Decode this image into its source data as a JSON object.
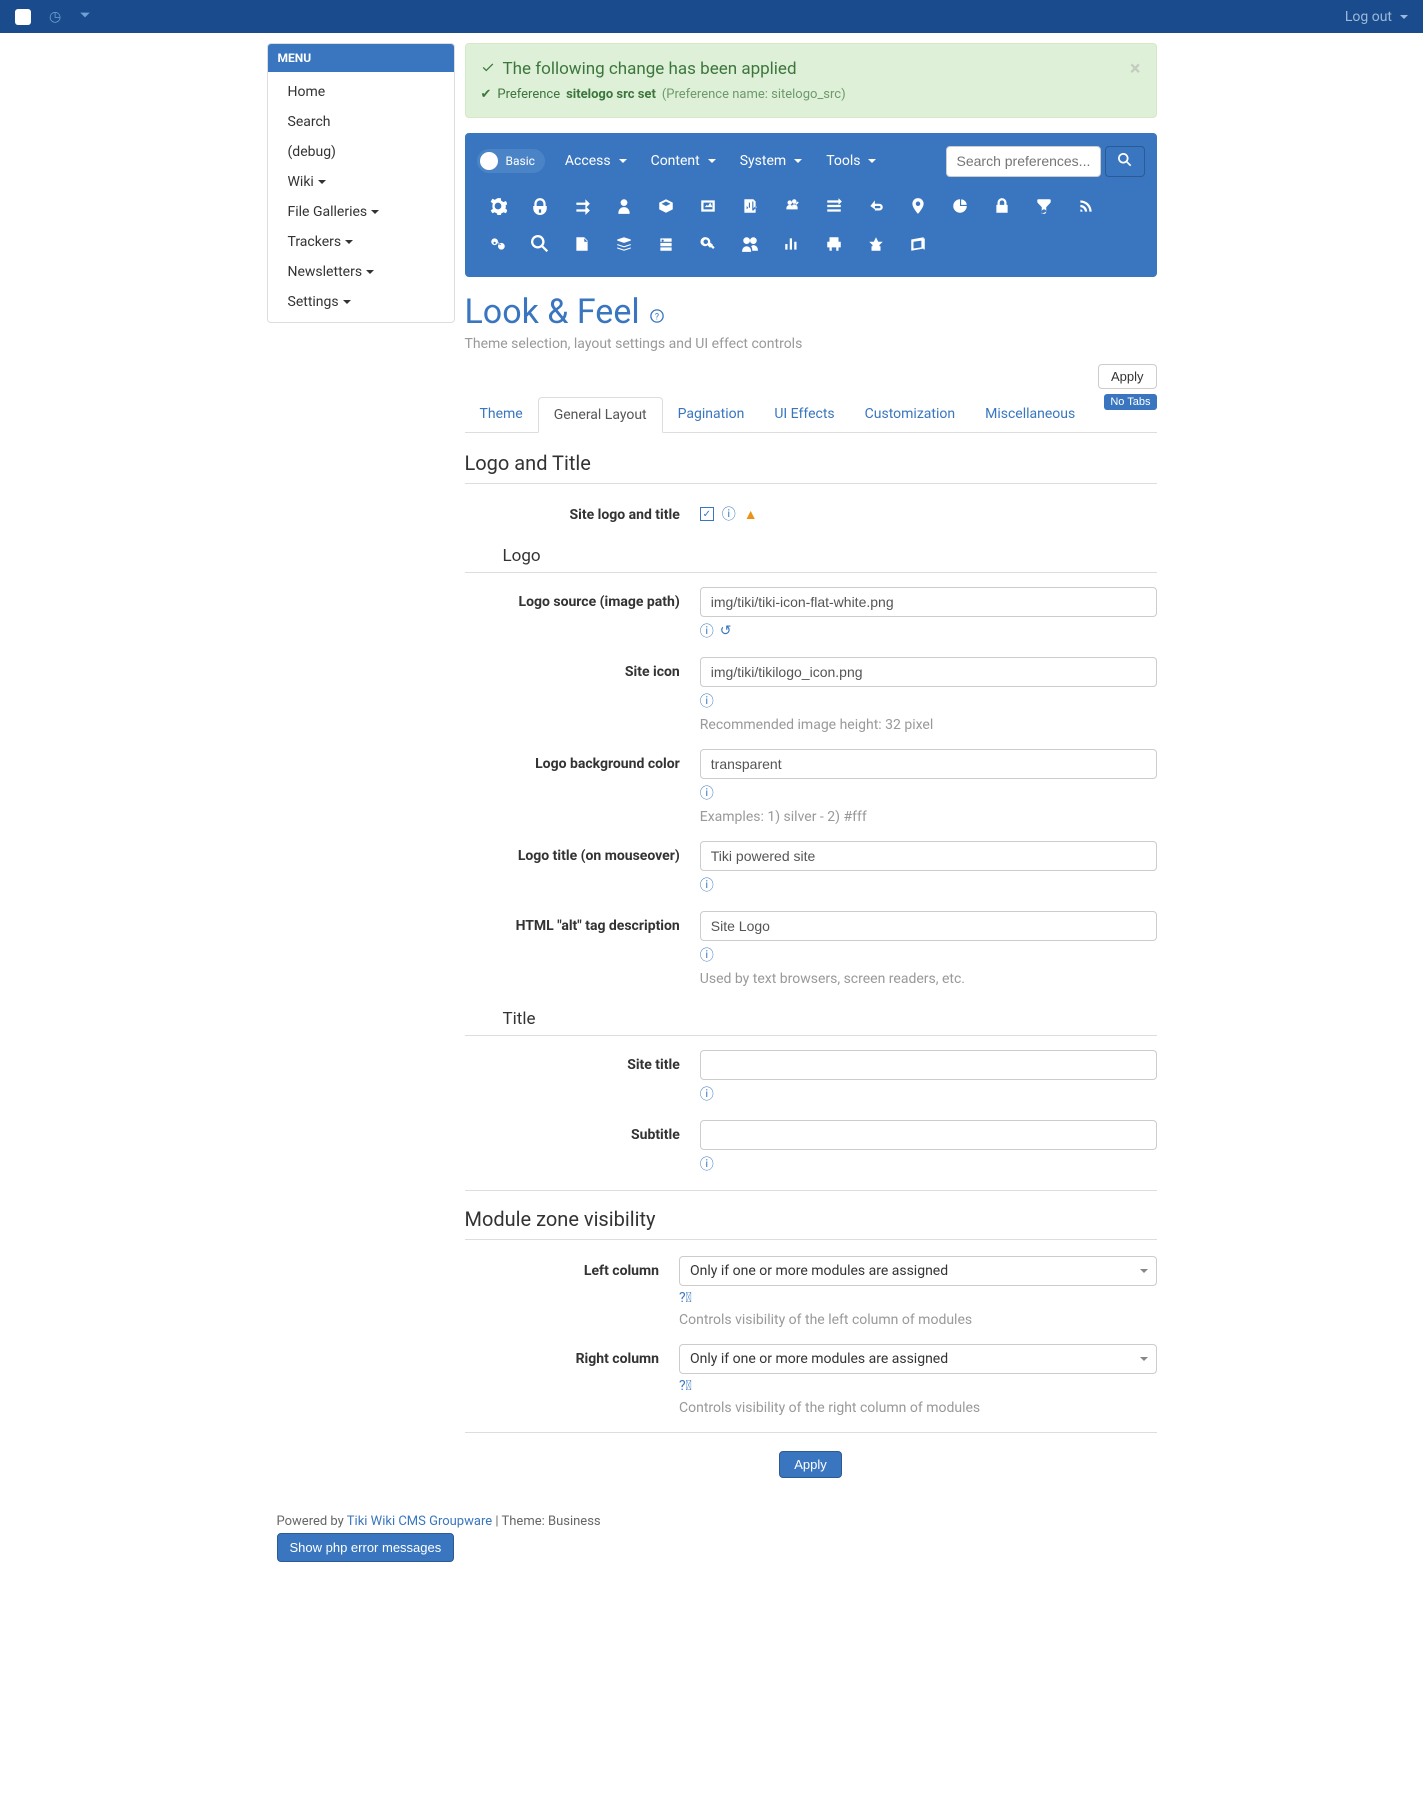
{
  "topbar": {
    "logout_label": "Log out"
  },
  "sidebar": {
    "header": "MENU",
    "items": [
      {
        "label": "Home",
        "caret": false
      },
      {
        "label": "Search",
        "caret": false
      },
      {
        "label": "(debug)",
        "caret": false
      },
      {
        "label": "Wiki",
        "caret": true
      },
      {
        "label": "File Galleries",
        "caret": true
      },
      {
        "label": "Trackers",
        "caret": true
      },
      {
        "label": "Newsletters",
        "caret": true
      },
      {
        "label": "Settings",
        "caret": true
      }
    ]
  },
  "alert": {
    "title": "The following change has been applied",
    "pref_label": "Preference",
    "pref_bold": "sitelogo src set",
    "pref_hint": "(Preference name: sitelogo_src)"
  },
  "prefnav": {
    "basic_label": "Basic",
    "links": [
      "Access",
      "Content",
      "System",
      "Tools"
    ],
    "search_placeholder": "Search preferences..."
  },
  "page": {
    "title": "Look & Feel",
    "subtitle": "Theme selection, layout settings and UI effect controls",
    "apply_label": "Apply",
    "no_tabs_label": "No Tabs"
  },
  "tabs": [
    "Theme",
    "General Layout",
    "Pagination",
    "UI Effects",
    "Customization",
    "Miscellaneous"
  ],
  "active_tab": 1,
  "section1": {
    "heading": "Logo and Title",
    "site_logo_title_label": "Site logo and title",
    "logo_heading": "Logo",
    "logo_source_label": "Logo source (image path)",
    "logo_source_value": "img/tiki/tiki-icon-flat-white.png",
    "site_icon_label": "Site icon",
    "site_icon_value": "img/tiki/tikilogo_icon.png",
    "site_icon_help": "Recommended image height: 32 pixel",
    "logo_bg_label": "Logo background color",
    "logo_bg_value": "transparent",
    "logo_bg_help": "Examples: 1) silver - 2) #fff",
    "logo_title_label": "Logo title (on mouseover)",
    "logo_title_value": "Tiki powered site",
    "alt_label": "HTML \"alt\" tag description",
    "alt_value": "Site Logo",
    "alt_help": "Used by text browsers, screen readers, etc.",
    "title_heading": "Title",
    "site_title_label": "Site title",
    "site_title_value": "",
    "subtitle_label": "Subtitle",
    "subtitle_value": ""
  },
  "section2": {
    "heading": "Module zone visibility",
    "left_label": "Left column",
    "left_value": "Only if one or more modules are assigned",
    "left_help": "Controls visibility of the left column of modules",
    "right_label": "Right column",
    "right_value": "Only if one or more modules are assigned",
    "right_help": "Controls visibility of the right column of modules"
  },
  "footer": {
    "powered": "Powered by ",
    "tiki_link": "Tiki Wiki CMS Groupware",
    "theme_suffix": "  | Theme: Business",
    "php_err": "Show php error messages"
  }
}
